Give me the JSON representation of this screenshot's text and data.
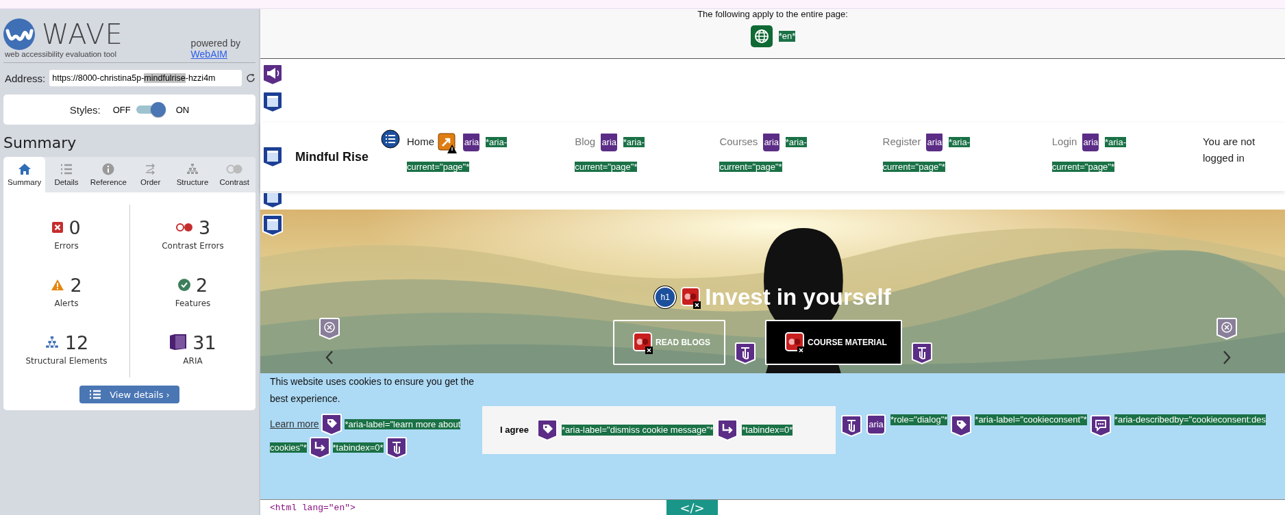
{
  "sidebar": {
    "logo": {
      "name": "WAVE",
      "tagline": "web accessibility evaluation tool",
      "powered_by": "powered by",
      "link": "WebAIM"
    },
    "address": {
      "label": "Address:",
      "value_parts": [
        {
          "text": "https://8000-christina5p-",
          "selected": false
        },
        {
          "text": "mindfulrise",
          "selected": true
        },
        {
          "text": "-hzzi4m",
          "selected": false
        }
      ]
    },
    "styles": {
      "label": "Styles:",
      "off_label": "OFF",
      "on_label": "ON",
      "on": true
    },
    "heading": "Summary",
    "tabs": [
      {
        "kind": "home",
        "label": "Summary",
        "selected": true
      },
      {
        "kind": "details",
        "label": "Details",
        "selected": false
      },
      {
        "kind": "reference",
        "label": "Reference",
        "selected": false
      },
      {
        "kind": "order",
        "label": "Order",
        "selected": false
      },
      {
        "kind": "structure",
        "label": "Structure",
        "selected": false
      },
      {
        "kind": "contrast",
        "label": "Contrast",
        "selected": false
      }
    ],
    "stats": [
      {
        "kind": "error",
        "count": "0",
        "label": "Errors"
      },
      {
        "kind": "contrast",
        "count": "3",
        "label": "Contrast Errors"
      },
      {
        "kind": "alert",
        "count": "2",
        "label": "Alerts"
      },
      {
        "kind": "feature",
        "count": "2",
        "label": "Features"
      },
      {
        "kind": "structure",
        "count": "12",
        "label": "Structural Elements"
      },
      {
        "kind": "aria",
        "count": "31",
        "label": "ARIA"
      }
    ],
    "button": "View details ›"
  },
  "page_notice": {
    "text": "The following apply to the entire page:",
    "marks": [
      {
        "kind": "language"
      },
      {
        "kind": "note",
        "text": "*en*"
      }
    ]
  },
  "nav": {
    "brand": "Mindful Rise",
    "items": [
      {
        "label": "Home",
        "selected": true,
        "marks": [
          {
            "kind": "alert"
          },
          {
            "kind": "aria",
            "text": "aria"
          },
          {
            "kind": "note",
            "text": "*aria-current=\"page\"*"
          }
        ]
      },
      {
        "label": "Blog",
        "selected": false,
        "marks": [
          {
            "kind": "aria",
            "text": "aria"
          },
          {
            "kind": "note",
            "text": "*aria-current=\"page\"*"
          }
        ]
      },
      {
        "label": "Courses",
        "selected": false,
        "marks": [
          {
            "kind": "aria",
            "text": "aria"
          },
          {
            "kind": "note",
            "text": "*aria-current=\"page\"*"
          }
        ]
      },
      {
        "label": "Register",
        "selected": false,
        "marks": [
          {
            "kind": "aria",
            "text": "aria"
          },
          {
            "kind": "note",
            "text": "*aria-current=\"page\"*"
          }
        ]
      },
      {
        "label": "Login",
        "selected": false,
        "marks": [
          {
            "kind": "aria",
            "text": "aria"
          },
          {
            "kind": "note",
            "text": "*aria-current=\"page\"*"
          }
        ]
      }
    ],
    "status": "You are not logged in"
  },
  "hero": {
    "heading": "Invest in yourself",
    "heading_marks": [
      {
        "kind": "heading",
        "text": "h1"
      },
      {
        "kind": "contrast"
      }
    ],
    "buttons": [
      {
        "label": "READ BLOGS",
        "selected": false
      },
      {
        "label": "COURSE MATERIAL",
        "selected": true
      }
    ]
  },
  "cookie": {
    "text": "This website uses cookies to ensure you get the best experience.",
    "link": "Learn more",
    "link_marks": [
      {
        "kind": "tag"
      },
      {
        "kind": "note",
        "text": "*aria-label=\"learn more about cookies\"*"
      },
      {
        "kind": "tabstop"
      },
      {
        "kind": "note",
        "text": "*tabindex=0*"
      },
      {
        "kind": "handler"
      }
    ],
    "button": "I agree",
    "button_marks": [
      {
        "kind": "tag"
      },
      {
        "kind": "note",
        "text": "*aria-label=\"dismiss cookie message\"*"
      },
      {
        "kind": "tabstop"
      },
      {
        "kind": "note",
        "text": "*tabindex=0*"
      }
    ],
    "dialog_marks": [
      {
        "kind": "handler"
      },
      {
        "kind": "aria",
        "text": "aria"
      },
      {
        "kind": "note",
        "text": "*role=\"dialog\"*"
      },
      {
        "kind": "tag"
      },
      {
        "kind": "note",
        "text": "*aria-label=\"cookieconsent\"*"
      },
      {
        "kind": "describedby"
      },
      {
        "kind": "note",
        "text": "*aria-describedby=\"cookieconsent:des"
      }
    ]
  },
  "code": {
    "source": "<html lang=\"en\">",
    "toggle": "</>"
  }
}
